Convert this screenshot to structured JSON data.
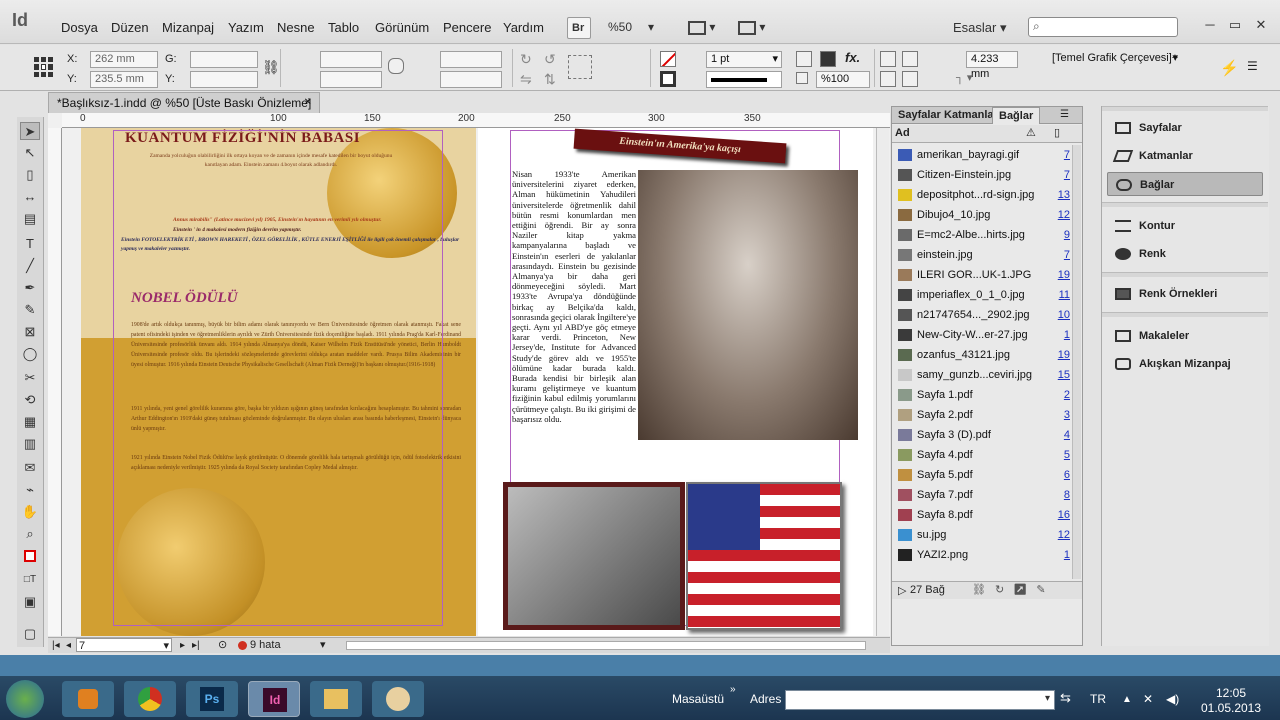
{
  "app": {
    "logo": "Id"
  },
  "menu": [
    "Dosya",
    "Düzen",
    "Mizanpaj",
    "Yazım",
    "Nesne",
    "Tablo",
    "Görünüm",
    "Pencere",
    "Yardım"
  ],
  "menubar": {
    "br_label": "Br",
    "zoom": "%50",
    "workspace": "Esaslar",
    "workspace_arrow": "▾"
  },
  "control": {
    "x_label": "X:",
    "x_value": "262 mm",
    "y_label": "Y:",
    "y_value": "235.5 mm",
    "g_label": "G:",
    "h_label": "Y:",
    "stroke_weight": "1 pt",
    "scale": "%100",
    "width_value": "4.233 mm",
    "frame_style": "[Temel Grafik Çerçevesi]+"
  },
  "document": {
    "tab_title": "*Başlıksız-1.indd @ %50 [Üste Baskı Önizleme]",
    "tab_close": "✕",
    "ruler_marks": [
      "0",
      "50",
      "100",
      "150",
      "200",
      "250",
      "300",
      "350"
    ],
    "left_page": {
      "heading": "KUANTUM FİZİĞİ'NİN BABASI",
      "intro": "Zamanda yolculuğun olabilirliğini ilk ortaya koyan ve de zamanın içinde mesafe katedilen bir boyut olduğunu kanıtlayan adam. Einstein zamanı 4.boyut olarak adlandırdı.",
      "annus": "Annus mirabilis\" (Latince mucizevi yıl) 1905, Einstein'ın hayatının en verimli yılı olmuştur.",
      "annus2": "Einstein ' in 4 makalesi modern fiziğin devrim yapmıştır.",
      "annus3": "Einstein FOTOELEKTRİK ETİ , BROWN HAREKETİ , ÖZEL GÖRELİLİK , KÜTLE ENERJİ EŞİTLİĞİ ile ilgili çok önemli çalışmalar , buluşlar yapmış ve makaleler yazmıştır.",
      "nobel_title": "NOBEL ÖDÜLÜ",
      "nobel_p1": "1908'de artık oldukça tanınmış, büyük bir bilim adamı olarak tanınıyordu ve Bern Üniversitesinde öğretmen olarak atanmıştı. Fakat sene patent ofisindeki işinden ve öğretmenliklerin ayrıldı ve Zürih Üniversitesinde fizik doçentliğine başladı. 1911 yılında Prag'da Karl-Ferdinand Üniversitesinde profesörlük ünvanı aldı. 1914 yılında Almanya'ya döndü, Kaiser Wilhelm Fizik Enstitüsü'nde yönetici, Berlin Humboldt Üniversitesinde profesör oldu. Bu işlerindeki sözleşmelerinde görevlerini oldukça aratan maddeler vardı. Prusya Bilim Akademisinin bir üyesi olmuştur. 1916 yılında Einstein Deutsche Physikalische Gesellschaft (Alman Fizik Derneği)'in başkanı olmuştur.(1916-1918)",
      "nobel_p2": "1911 yılında, yeni genel görelilik kuramına göre, başka bir yıldızın ışığının güneş tarafından kırılacağını hesaplamıştır. Bu tahmini sonradan Arthur Eddington'ın 1919'daki güneş tutulması gözleminde doğrulanmıştır. Bu olayın ulusları arası basında haberleşmesi, Einstein'ı dünyaca ünlü yapmıştır.",
      "nobel_p3": "1921 yılında Einstein Nobel Fizik Ödülü'ne layık görülmüştür. O dönemde görelilik hala tartışmalı görüldüğü için, ödül fotoelektrik etkisini açıklaması nedeniyle verilmiştir. 1925 yılında da Royal Society tarafından Copley Medal almıştır."
    },
    "right_page": {
      "banner": "Einstein'ın Amerika'ya kaçışı",
      "body": "Nisan 1933'te Amerikan üniversitelerini ziyaret ederken, Alman hükümetinin Yahudileri üniversitelerde öğretmenlik dahil bütün resmi konumlardan men ettiğini öğrendi. Bir ay sonra Naziler kitap yakma kampanyalarına başladı ve Einstein'ın eserleri de yakılanlar arasındaydı. Einstein bu gezisinde Almanya'ya bir daha geri dönmeyeceğini söyledi. Mart 1933'te Avrupa'ya döndüğünde birkaç ay Belçika'da kaldı, sonrasında geçici olarak İngiltere'ye geçti. Aynı yıl ABD'ye göç etmeye karar verdi. Princeton, New Jersey'de, Institute for Advanced Study'de görev aldı ve 1955'te ölümüne kadar burada kaldı. Burada kendisi bir birleşik alan kuramı geliştirmeye ve kuantum fiziğinin kabul edilmiş yorumlarını çürütmeye çalıştı. Bu iki girişimi de başarısız oldu."
    },
    "status": {
      "page": "7",
      "errors": "9 hata"
    }
  },
  "links_panel": {
    "tabs": [
      "Sayfalar",
      "Katmanlar",
      "Bağlar"
    ],
    "header": "Ad",
    "rows": [
      {
        "name": "amerikan_bayragi.gif",
        "page": "7",
        "color": "#3b5bb5"
      },
      {
        "name": "Citizen-Einstein.jpg",
        "page": "7",
        "color": "#555555"
      },
      {
        "name": "depositphot...rd-sign.jpg",
        "page": "13",
        "color": "#e0c020"
      },
      {
        "name": "Dibujo4_10.jpg",
        "page": "12",
        "color": "#8a6a40"
      },
      {
        "name": "E=mc2-Albe...hirts.jpg",
        "page": "9",
        "color": "#6a6a6a"
      },
      {
        "name": "einstein.jpg",
        "page": "7",
        "color": "#777777"
      },
      {
        "name": "ILERI GOR...UK-1.JPG",
        "page": "19",
        "color": "#9a7a5a"
      },
      {
        "name": "imperiaflex_0_1_0.jpg",
        "page": "11",
        "color": "#444444"
      },
      {
        "name": "n21747654..._2902.jpg",
        "page": "10",
        "color": "#555555"
      },
      {
        "name": "New-City-W...er-27.jpg",
        "page": "1",
        "color": "#3a3a3a"
      },
      {
        "name": "ozanfus_43121.jpg",
        "page": "19",
        "color": "#5a6a50"
      },
      {
        "name": "samy_gunzb...ceviri.jpg",
        "page": "15",
        "color": "#c8c8c8"
      },
      {
        "name": "Sayfa 1.pdf",
        "page": "2",
        "color": "#8a9a8a"
      },
      {
        "name": "Sayfa 2.pdf",
        "page": "3",
        "color": "#b0a080"
      },
      {
        "name": "Sayfa 3 (D).pdf",
        "page": "4",
        "color": "#7a7a9a"
      },
      {
        "name": "Sayfa 4.pdf",
        "page": "5",
        "color": "#8a9a60"
      },
      {
        "name": "Sayfa 5.pdf",
        "page": "6",
        "color": "#c09040"
      },
      {
        "name": "Sayfa 7.pdf",
        "page": "8",
        "color": "#a05060"
      },
      {
        "name": "Sayfa 8.pdf",
        "page": "16",
        "color": "#a04050"
      },
      {
        "name": "su.jpg",
        "page": "12",
        "color": "#3a90d0"
      },
      {
        "name": "YAZI2.png",
        "page": "1",
        "color": "#222222"
      }
    ],
    "footer_count": "27 Bağ"
  },
  "dock": {
    "items": [
      "Sayfalar",
      "Katmanlar",
      "Bağlar",
      "Kontur",
      "Renk",
      "Renk Örnekleri",
      "Makaleler",
      "Akışkan Mizanpaj"
    ]
  },
  "taskbar": {
    "desktop": "Masaüstü",
    "address_label": "Adres",
    "lang": "TR",
    "time": "12:05",
    "date": "01.05.2013"
  }
}
